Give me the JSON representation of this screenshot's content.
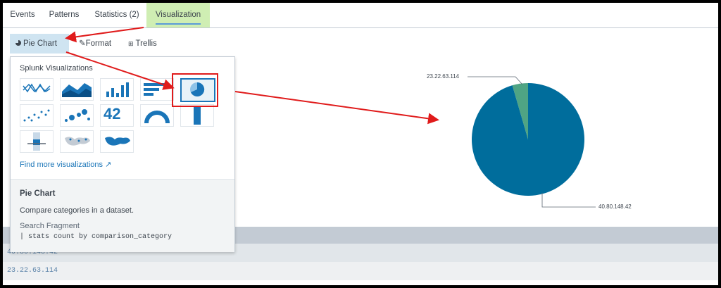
{
  "tabs": [
    {
      "label": "Events"
    },
    {
      "label": "Patterns"
    },
    {
      "label": "Statistics (2)"
    },
    {
      "label": "Visualization"
    }
  ],
  "subbar": {
    "pie_label": "Pie Chart",
    "format_label": "Format",
    "trellis_label": "Trellis"
  },
  "dropdown": {
    "title": "Splunk Visualizations",
    "find_more": "Find more visualizations",
    "selected_name": "Pie Chart",
    "selected_desc": "Compare categories in a dataset.",
    "fragment_title": "Search Fragment",
    "fragment_code": "| stats count by comparison_category",
    "icons": [
      "line-chart-icon",
      "area-chart-icon",
      "column-chart-icon",
      "bar-chart-icon",
      "pie-chart-icon",
      "scatter-chart-icon",
      "bubble-chart-icon",
      "single-value-icon",
      "radial-gauge-icon",
      "filler-gauge-icon",
      "marker-gauge-icon",
      "cluster-map-icon",
      "choropleth-map-icon"
    ],
    "single_value_text": "42"
  },
  "chart_data": {
    "type": "pie",
    "slices": [
      {
        "label": "40.80.148.42",
        "value": 95.5,
        "color": "#006d9c"
      },
      {
        "label": "23.22.63.114",
        "value": 4.5,
        "color": "#4fa484"
      }
    ]
  },
  "table": {
    "rows": [
      "40.80.148.42",
      "23.22.63.114"
    ]
  },
  "colors": {
    "annotation": "#e01b1b",
    "active_tab": "#cfeeb3",
    "selected_button": "#cfe4f1"
  }
}
